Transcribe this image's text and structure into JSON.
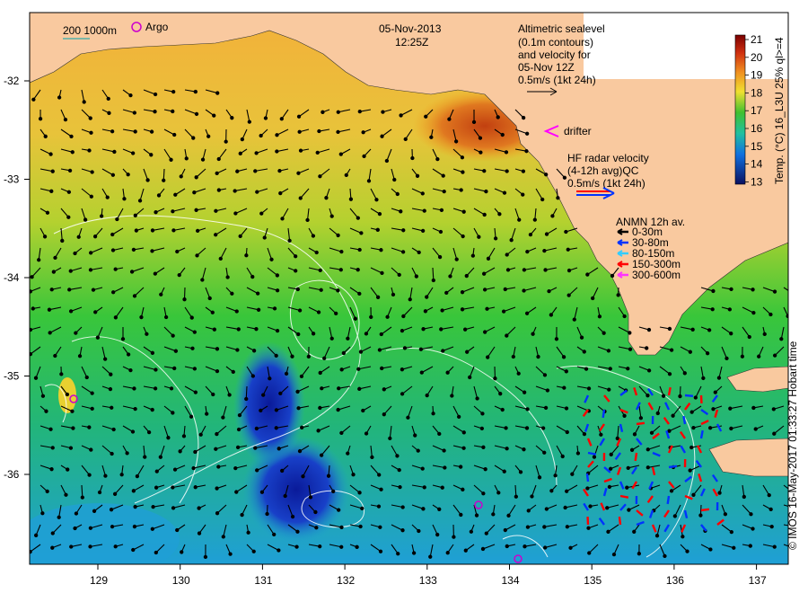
{
  "map": {
    "date": "05-Nov-2013",
    "time": "12:25Z",
    "scale_label": "200  1000m",
    "argo_label": "Argo",
    "altimetry_lines": [
      "Altimetric sealevel",
      "(0.1m contours)",
      "and velocity for",
      "05-Nov 12Z",
      "0.5m/s (1kt 24h)"
    ],
    "drifter_label": "drifter",
    "hf_lines": [
      "HF radar velocity",
      "(4-12h avg)QC",
      "0.5m/s (1kt 24h)"
    ],
    "anmn_title": "ANMN 12h av.",
    "anmn_entries": [
      {
        "label": "0-30m",
        "color": "#000000"
      },
      {
        "label": "30-80m",
        "color": "#0033ff"
      },
      {
        "label": "80-150m",
        "color": "#33ccff"
      },
      {
        "label": "150-300m",
        "color": "#ff0000"
      },
      {
        "label": "300-600m",
        "color": "#ff33ff"
      }
    ],
    "colorbar_title": "Temp. (°C) 16_L3U 25% ql>=4",
    "colorbar_ticks": [
      "21",
      "20",
      "19",
      "18",
      "17",
      "16",
      "15",
      "14",
      "13"
    ],
    "lon_ticks": [
      "129",
      "130",
      "131",
      "132",
      "133",
      "134",
      "135",
      "136",
      "137"
    ],
    "lat_ticks": [
      "-32",
      "-33",
      "-34",
      "-35",
      "-36"
    ],
    "credit": "© IMOS 16-May-2017 01:33:27 Hobart time",
    "colors": {
      "land": "#f9c99f",
      "sst_warm": "#f0a020",
      "sst_mid": "#30c030",
      "sst_cool": "#2080e0",
      "sst_cold": "#102090",
      "hf_red": "#ff0000",
      "hf_blue": "#0033ff",
      "argo": "#cc00cc"
    }
  }
}
